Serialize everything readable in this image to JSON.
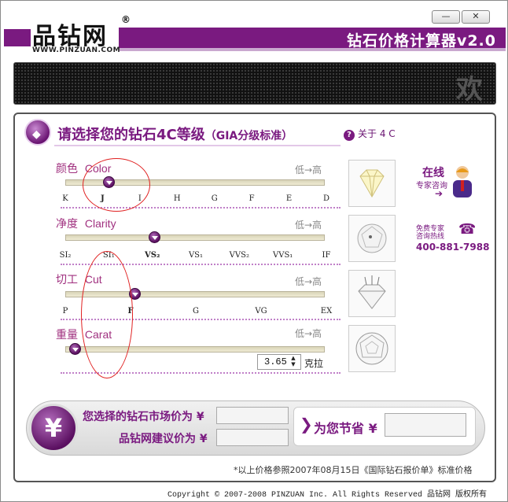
{
  "window": {
    "app_title": "钻石价格计算器v2.0",
    "minimize_label": "—",
    "close_label": "✕"
  },
  "logo": {
    "text": "品钻网",
    "reg": "®",
    "url": "WWW.PINZUAN.COM"
  },
  "led": {
    "text": "欢"
  },
  "header": {
    "title": "请选择您的钻石4C等级",
    "subtitle": "（GIA分级标准）",
    "about_label": "关于 4 C",
    "about_icon": "question-icon"
  },
  "low_high": "低→高",
  "rows": [
    {
      "label_cn": "颜色",
      "label_en": "Color",
      "value_fraction": 0.141,
      "ticks": [
        {
          "label": "K"
        },
        {
          "label": "J"
        },
        {
          "label": "I"
        },
        {
          "label": "H"
        },
        {
          "label": "G"
        },
        {
          "label": "F"
        },
        {
          "label": "E"
        },
        {
          "label": "D"
        }
      ],
      "selected": "J"
    },
    {
      "label_cn": "净度",
      "label_en": "Clarity",
      "value_fraction": 0.333,
      "ticks": [
        {
          "label": "SI₂"
        },
        {
          "label": "SI₁"
        },
        {
          "label": "VS₂"
        },
        {
          "label": "VS₁"
        },
        {
          "label": "VVS₂"
        },
        {
          "label": "VVS₁"
        },
        {
          "label": "IF"
        }
      ],
      "selected": "VS₂"
    },
    {
      "label_cn": "切工",
      "label_en": "Cut",
      "value_fraction": 0.25,
      "ticks": [
        {
          "label": "P"
        },
        {
          "label": "F"
        },
        {
          "label": "G"
        },
        {
          "label": "VG"
        },
        {
          "label": "EX"
        }
      ],
      "selected": "F"
    },
    {
      "label_cn": "重量",
      "label_en": "Carat",
      "value_fraction": 0.0,
      "ticks": [],
      "selected": ""
    }
  ],
  "carat": {
    "value": "3.65",
    "unit": "克拉",
    "spin_up": "▲",
    "spin_down": "▼"
  },
  "consult": {
    "online": "在线",
    "expert": "专家咨询",
    "arrow": "➔",
    "free_line1": "免费专家",
    "free_line2": "咨询热线",
    "hotline": "400-881-7988"
  },
  "price": {
    "yen_symbol": "¥",
    "market_label": "您选择的钻石市场价为 ¥",
    "suggest_label": "品钻网建议价为 ¥",
    "market_value": "",
    "suggest_value": "",
    "save_label": "为您节省 ¥",
    "save_value": "",
    "save_arrow": "❯"
  },
  "footnote": "*以上价格参照2007年08月15日《国际钻石报价单》标准价格",
  "copyright": "Copyright © 2007-2008 PINZUAN Inc. All Rights Reserved 品钻网 版权所有",
  "colors": {
    "brand": "#7a1a80",
    "annotation": "#e02020"
  }
}
